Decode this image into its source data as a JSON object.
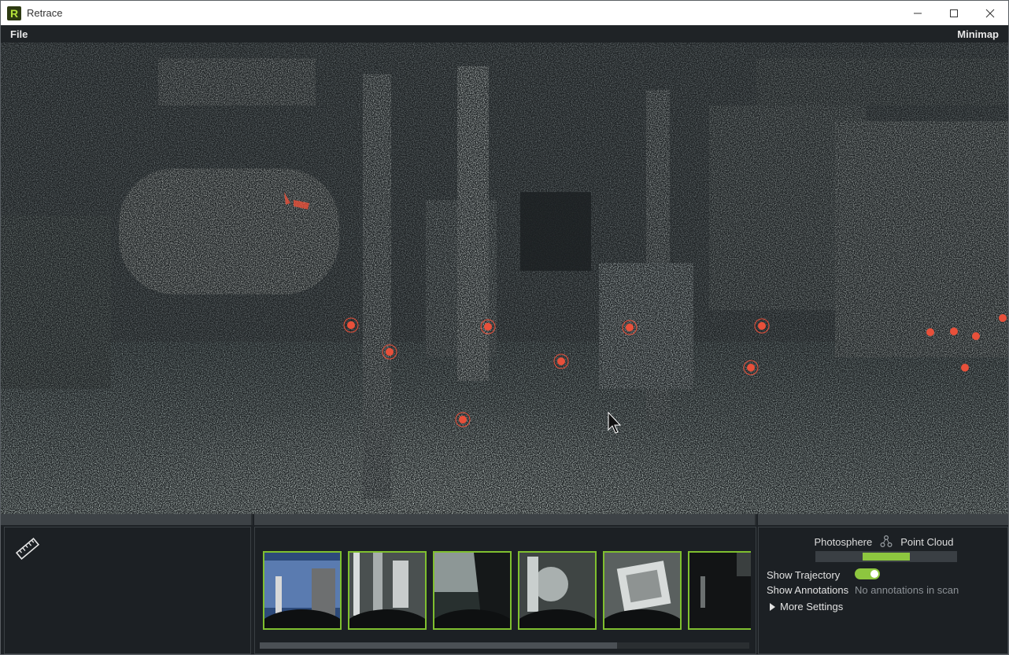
{
  "window": {
    "logo_letter": "R",
    "title": "Retrace",
    "controls": [
      "minimize-icon",
      "maximize-icon",
      "close-icon"
    ]
  },
  "menu": {
    "file": "File",
    "minimap": "Minimap"
  },
  "viewport": {
    "marker_color": "#e8503a"
  },
  "tools": {
    "ruler_icon": "ruler-icon"
  },
  "thumbnails": {
    "count": 6,
    "border_color": "#7fbf2f"
  },
  "settings": {
    "mode_left": "Photosphere",
    "mode_right": "Point Cloud",
    "mode_icon": "network-icon",
    "accent": "#8dc63f",
    "show_trajectory_label": "Show Trajectory",
    "show_trajectory_on": true,
    "show_annotations_label": "Show Annotations",
    "annotations_status": "No annotations in scan",
    "more_settings": "More Settings"
  }
}
